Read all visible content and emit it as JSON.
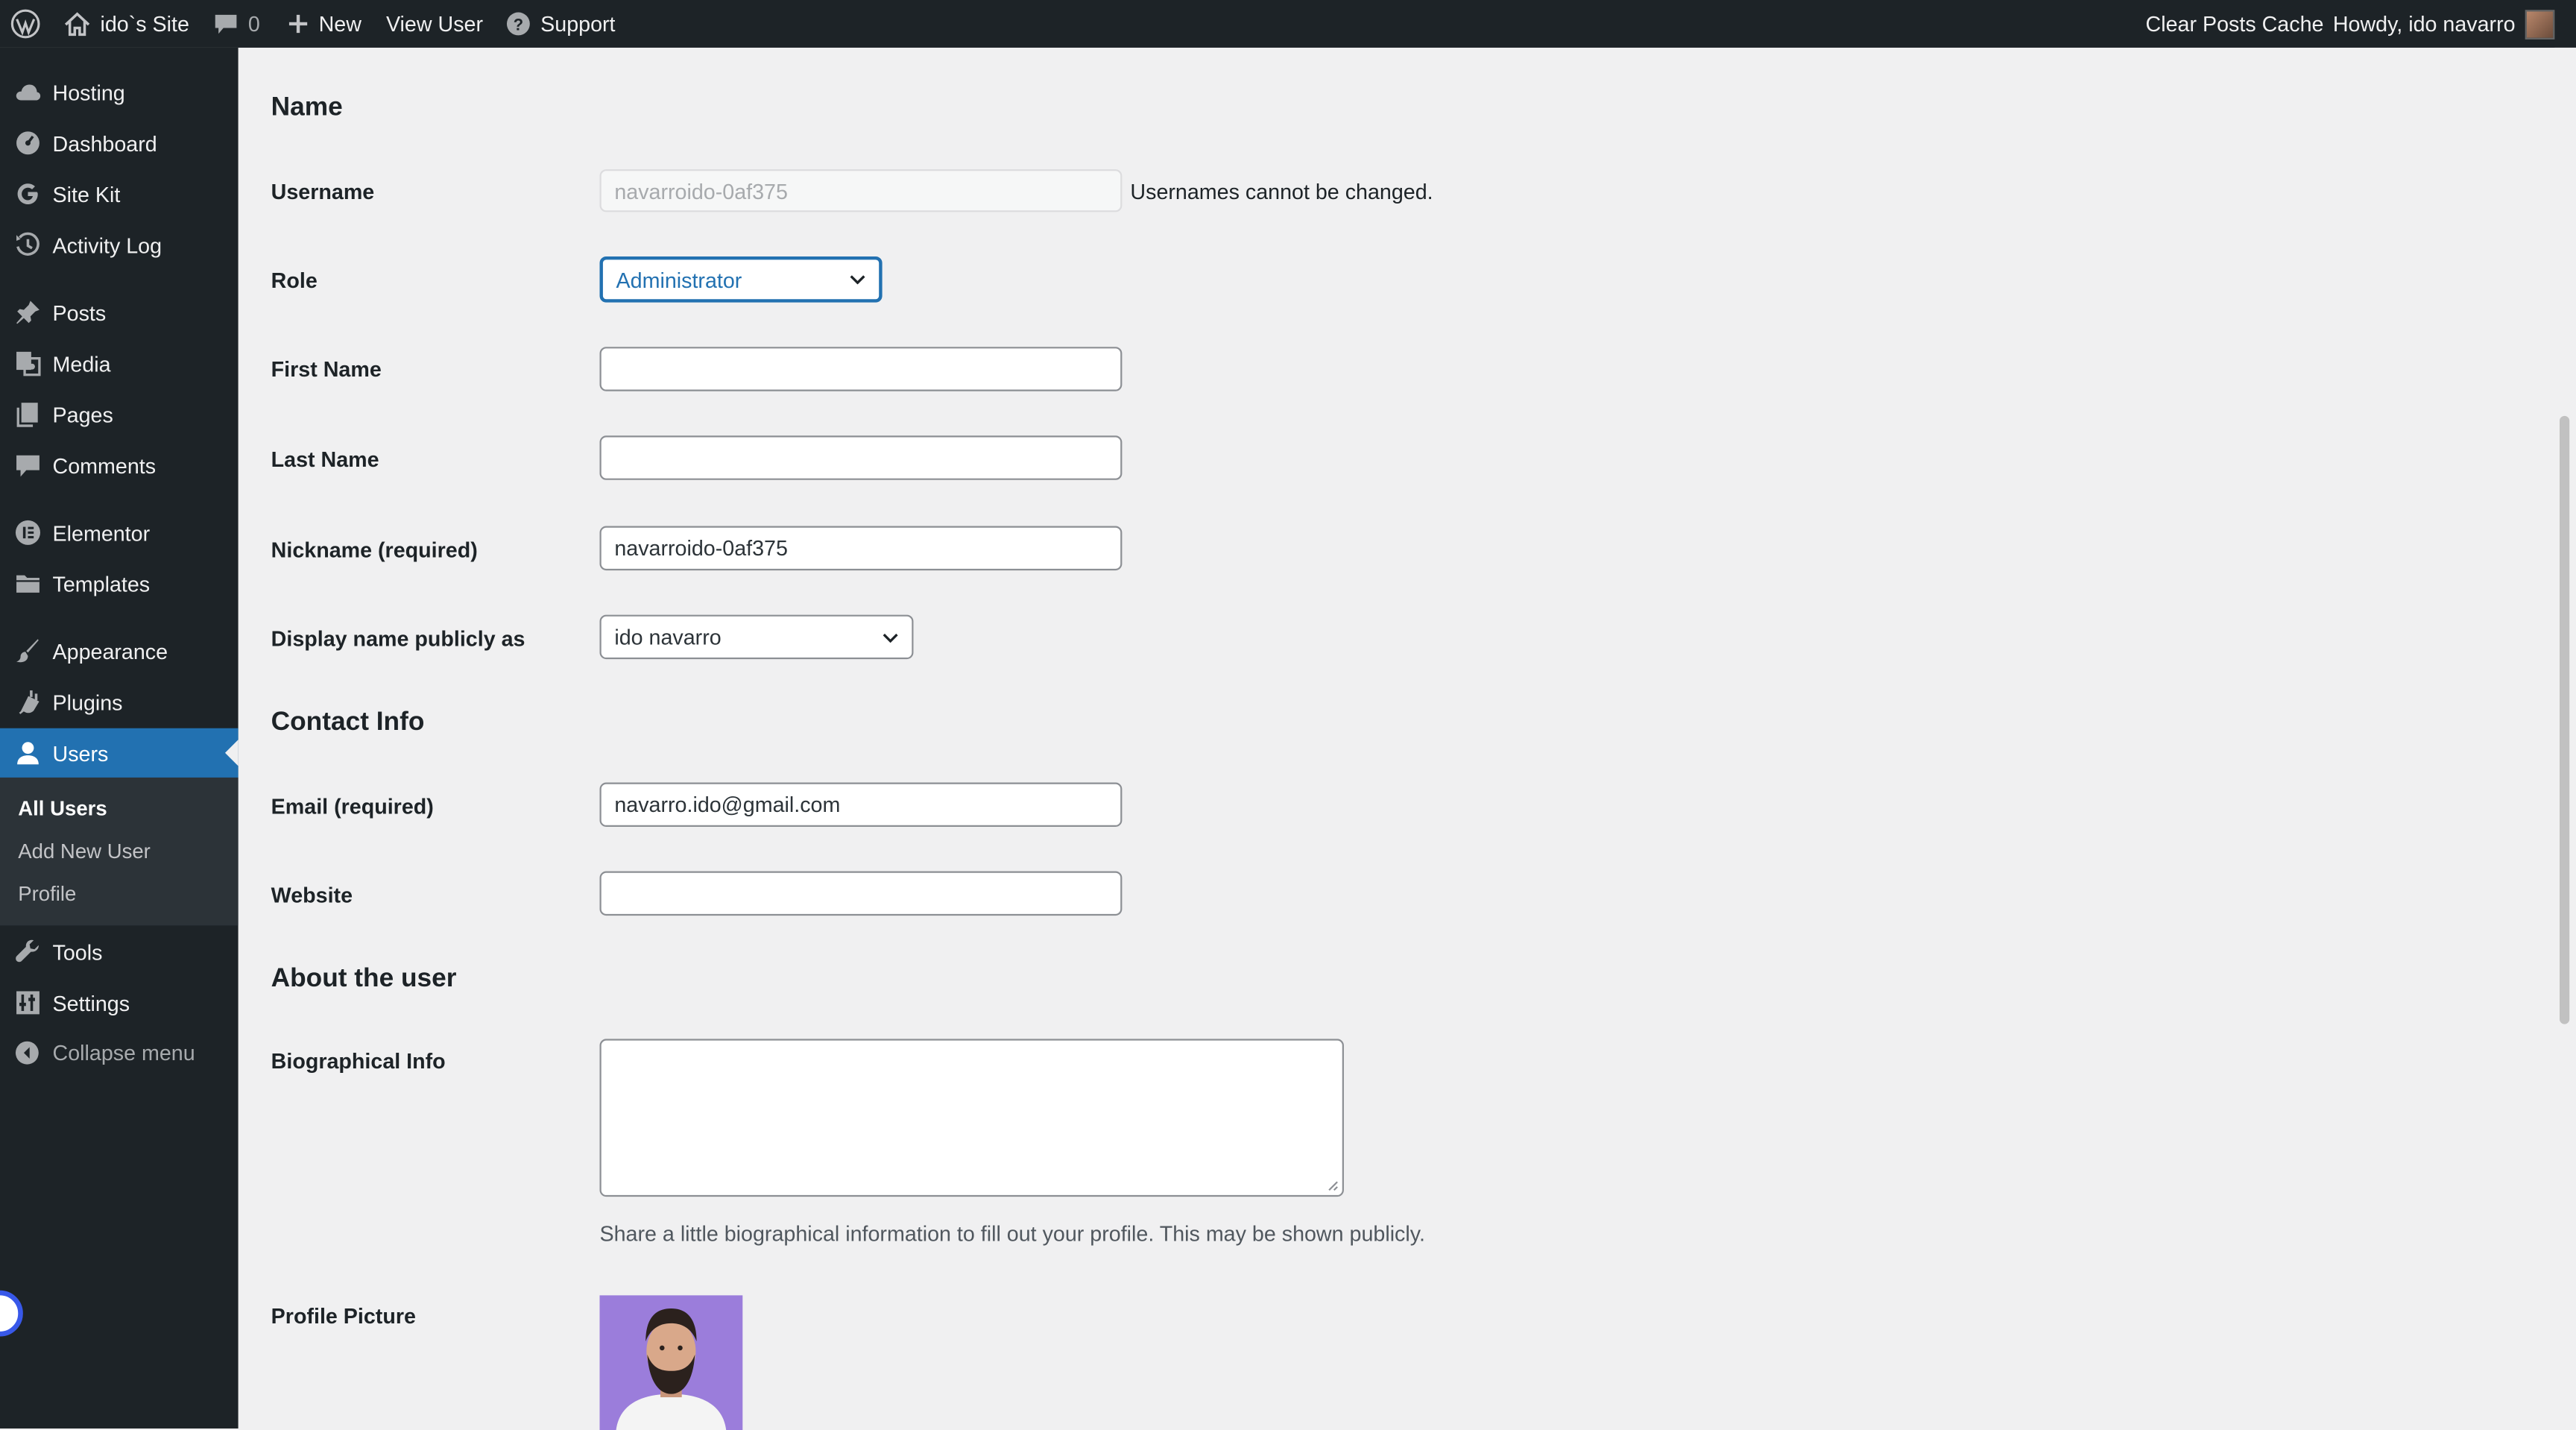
{
  "adminbar": {
    "site_name": "ido`s Site",
    "comments_count": "0",
    "new_label": "New",
    "view_user_label": "View User",
    "support_label": "Support",
    "clear_cache_label": "Clear Posts Cache",
    "howdy_label": "Howdy, ido navarro"
  },
  "sidebar": {
    "items": [
      {
        "label": "Hosting",
        "icon": "cloud-icon"
      },
      {
        "label": "Dashboard",
        "icon": "dashboard-icon"
      },
      {
        "label": "Site Kit",
        "icon": "google-g-icon"
      },
      {
        "label": "Activity Log",
        "icon": "history-icon"
      },
      {
        "label": "Posts",
        "icon": "pin-icon"
      },
      {
        "label": "Media",
        "icon": "media-icon"
      },
      {
        "label": "Pages",
        "icon": "pages-icon"
      },
      {
        "label": "Comments",
        "icon": "comment-icon"
      },
      {
        "label": "Elementor",
        "icon": "elementor-icon"
      },
      {
        "label": "Templates",
        "icon": "folder-icon"
      },
      {
        "label": "Appearance",
        "icon": "brush-icon"
      },
      {
        "label": "Plugins",
        "icon": "plug-icon"
      },
      {
        "label": "Users",
        "icon": "user-icon"
      },
      {
        "label": "Tools",
        "icon": "wrench-icon"
      },
      {
        "label": "Settings",
        "icon": "settings-icon"
      }
    ],
    "submenu": [
      "All Users",
      "Add New User",
      "Profile"
    ],
    "collapse_label": "Collapse menu"
  },
  "form": {
    "name_heading": "Name",
    "username_label": "Username",
    "username_value": "navarroido-0af375",
    "username_note": "Usernames cannot be changed.",
    "role_label": "Role",
    "role_value": "Administrator",
    "first_name_label": "First Name",
    "first_name_value": "",
    "last_name_label": "Last Name",
    "last_name_value": "",
    "nickname_label": "Nickname (required)",
    "nickname_value": "navarroido-0af375",
    "display_name_label": "Display name publicly as",
    "display_name_value": "ido navarro",
    "contact_heading": "Contact Info",
    "email_label": "Email (required)",
    "email_value": "navarro.ido@gmail.com",
    "website_label": "Website",
    "website_value": "",
    "about_heading": "About the user",
    "bio_label": "Biographical Info",
    "bio_description": "Share a little biographical information to fill out your profile. This may be shown publicly.",
    "profile_picture_label": "Profile Picture"
  },
  "colors": {
    "adminbar_bg": "#1d2327",
    "accent": "#2271b1",
    "page_bg": "#f0f0f1"
  }
}
